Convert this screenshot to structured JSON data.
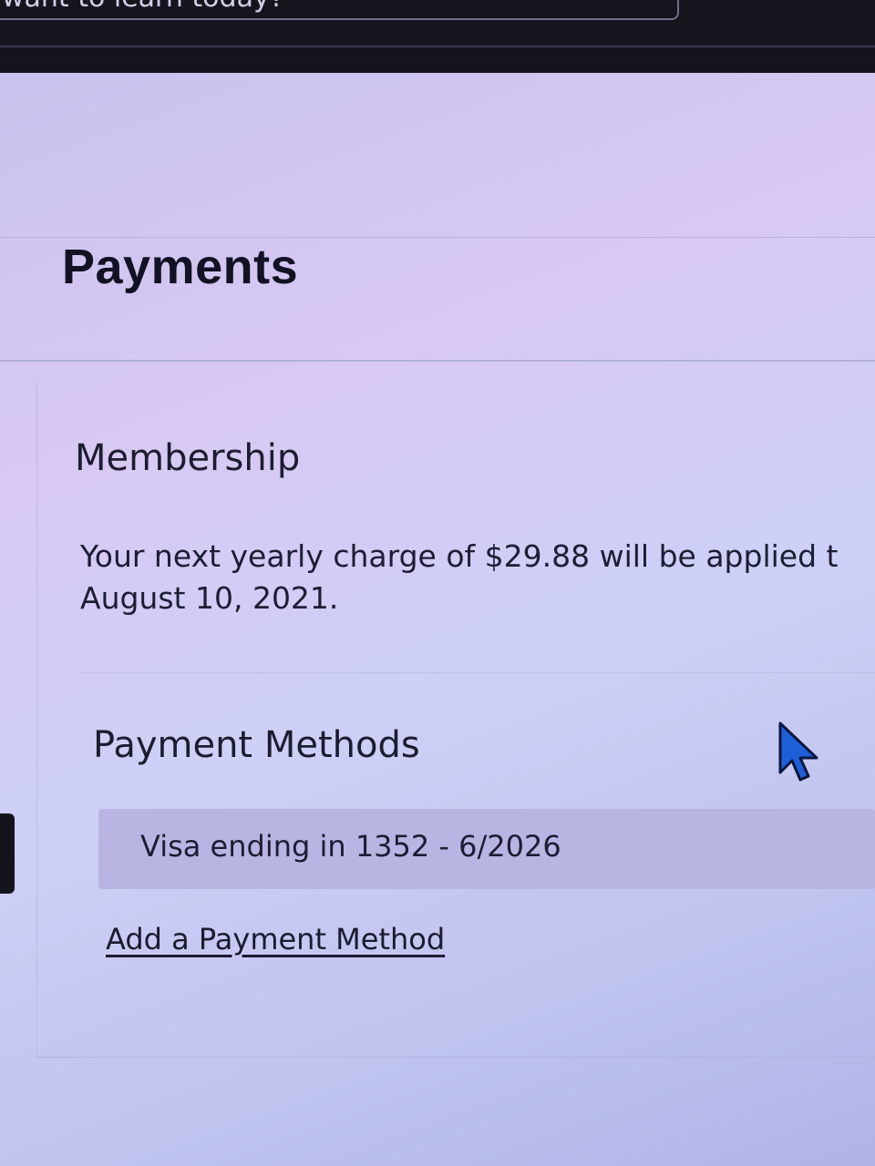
{
  "top_search": {
    "value": "want to learn today?"
  },
  "page": {
    "title": "Payments"
  },
  "membership": {
    "heading": "Membership",
    "line1": "Your next yearly charge of $29.88 will be applied t",
    "line2": "August 10, 2021."
  },
  "payment_methods": {
    "heading": "Payment Methods",
    "card_entry": "Visa ending in 1352 - 6/2026",
    "add_link": "Add a Payment Method"
  },
  "colors": {
    "accent": "#1f5fd8",
    "text": "#1d1d34",
    "page_bg": "#cdd0f6"
  },
  "icons": {
    "cursor": "mouse-pointer-icon"
  }
}
